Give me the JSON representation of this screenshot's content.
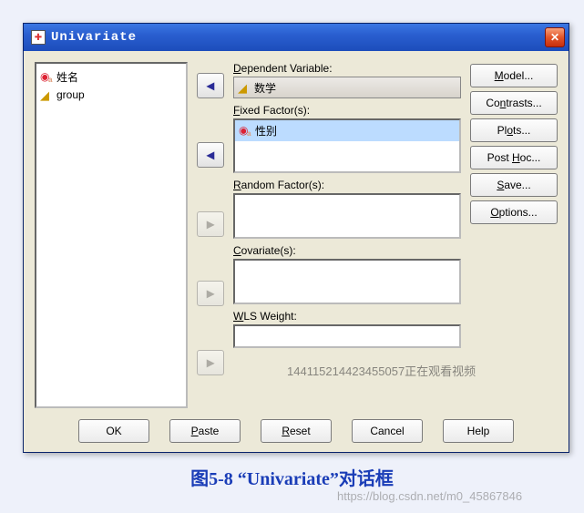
{
  "titlebar": {
    "title": "Univariate"
  },
  "source_vars": [
    {
      "name": "姓名",
      "icon": "nominal"
    },
    {
      "name": "group",
      "icon": "scale"
    }
  ],
  "sections": {
    "dependent": {
      "label_pre": "D",
      "label_rest": "ependent Variable:",
      "value": "数学",
      "value_icon": "scale"
    },
    "fixed": {
      "label_pre": "F",
      "label_rest": "ixed Factor(s):",
      "selected": "性别",
      "selected_icon": "nominal"
    },
    "random": {
      "label_pre": "R",
      "label_rest": "andom Factor(s):"
    },
    "covariate": {
      "label_pre": "C",
      "label_rest": "ovariate(s):"
    },
    "wls": {
      "label_pre": "W",
      "label_rest": "LS Weight:"
    }
  },
  "right_buttons": {
    "model": {
      "ul": "M",
      "rest": "odel..."
    },
    "contrasts": {
      "pre": "Co",
      "ul": "n",
      "rest": "trasts..."
    },
    "plots": {
      "pre": "Pl",
      "ul": "o",
      "rest": "ts..."
    },
    "posthoc": {
      "pre": "Post ",
      "ul": "H",
      "rest": "oc..."
    },
    "save": {
      "ul": "S",
      "rest": "ave..."
    },
    "options": {
      "ul": "O",
      "rest": "ptions..."
    }
  },
  "bottom": {
    "ok": "OK",
    "paste": {
      "ul": "P",
      "rest": "aste"
    },
    "reset": {
      "ul": "R",
      "rest": "eset"
    },
    "cancel": "Cancel",
    "help": "Help"
  },
  "caption": "图5-8  “Univariate”对话框",
  "watermark1": "144115214423455057正在观看视频",
  "watermark2": "https://blog.csdn.net/m0_45867846"
}
